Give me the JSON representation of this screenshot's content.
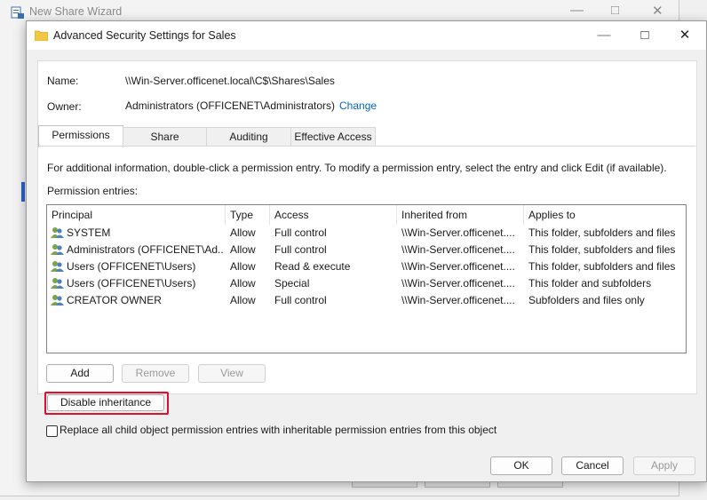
{
  "background_window": {
    "title": "New Share Wizard"
  },
  "dialog": {
    "title": "Advanced Security Settings for Sales",
    "name_label": "Name:",
    "name_value": "\\\\Win-Server.officenet.local\\C$\\Shares\\Sales",
    "owner_label": "Owner:",
    "owner_value": "Administrators (OFFICENET\\Administrators)",
    "change_link": "Change",
    "tabs": [
      "Permissions",
      "Share",
      "Auditing",
      "Effective Access"
    ],
    "info_text": "For additional information, double-click a permission entry. To modify a permission entry, select the entry and click Edit (if available).",
    "entries_label": "Permission entries:",
    "columns": [
      "Principal",
      "Type",
      "Access",
      "Inherited from",
      "Applies to"
    ],
    "rows": [
      {
        "principal": "SYSTEM",
        "type": "Allow",
        "access": "Full control",
        "inherited": "\\\\Win-Server.officenet....",
        "applies": "This folder, subfolders and files"
      },
      {
        "principal": "Administrators (OFFICENET\\Ad...",
        "type": "Allow",
        "access": "Full control",
        "inherited": "\\\\Win-Server.officenet....",
        "applies": "This folder, subfolders and files"
      },
      {
        "principal": "Users (OFFICENET\\Users)",
        "type": "Allow",
        "access": "Read & execute",
        "inherited": "\\\\Win-Server.officenet....",
        "applies": "This folder, subfolders and files"
      },
      {
        "principal": "Users (OFFICENET\\Users)",
        "type": "Allow",
        "access": "Special",
        "inherited": "\\\\Win-Server.officenet....",
        "applies": "This folder and subfolders"
      },
      {
        "principal": "CREATOR OWNER",
        "type": "Allow",
        "access": "Full control",
        "inherited": "\\\\Win-Server.officenet....",
        "applies": "Subfolders and files only"
      }
    ],
    "buttons": {
      "add": "Add",
      "remove": "Remove",
      "view": "View",
      "disable_inheritance": "Disable inheritance",
      "ok": "OK",
      "cancel": "Cancel",
      "apply": "Apply"
    },
    "replace_checkbox_label": "Replace all child object permission entries with inheritable permission entries from this object"
  },
  "colors": {
    "link": "#0066cc",
    "highlight_border": "#e0102b",
    "folder": "#f2c744"
  },
  "icons": [
    "wizard-icon",
    "folder-icon",
    "user-group-icon",
    "minimize-icon",
    "maximize-icon",
    "close-icon"
  ]
}
